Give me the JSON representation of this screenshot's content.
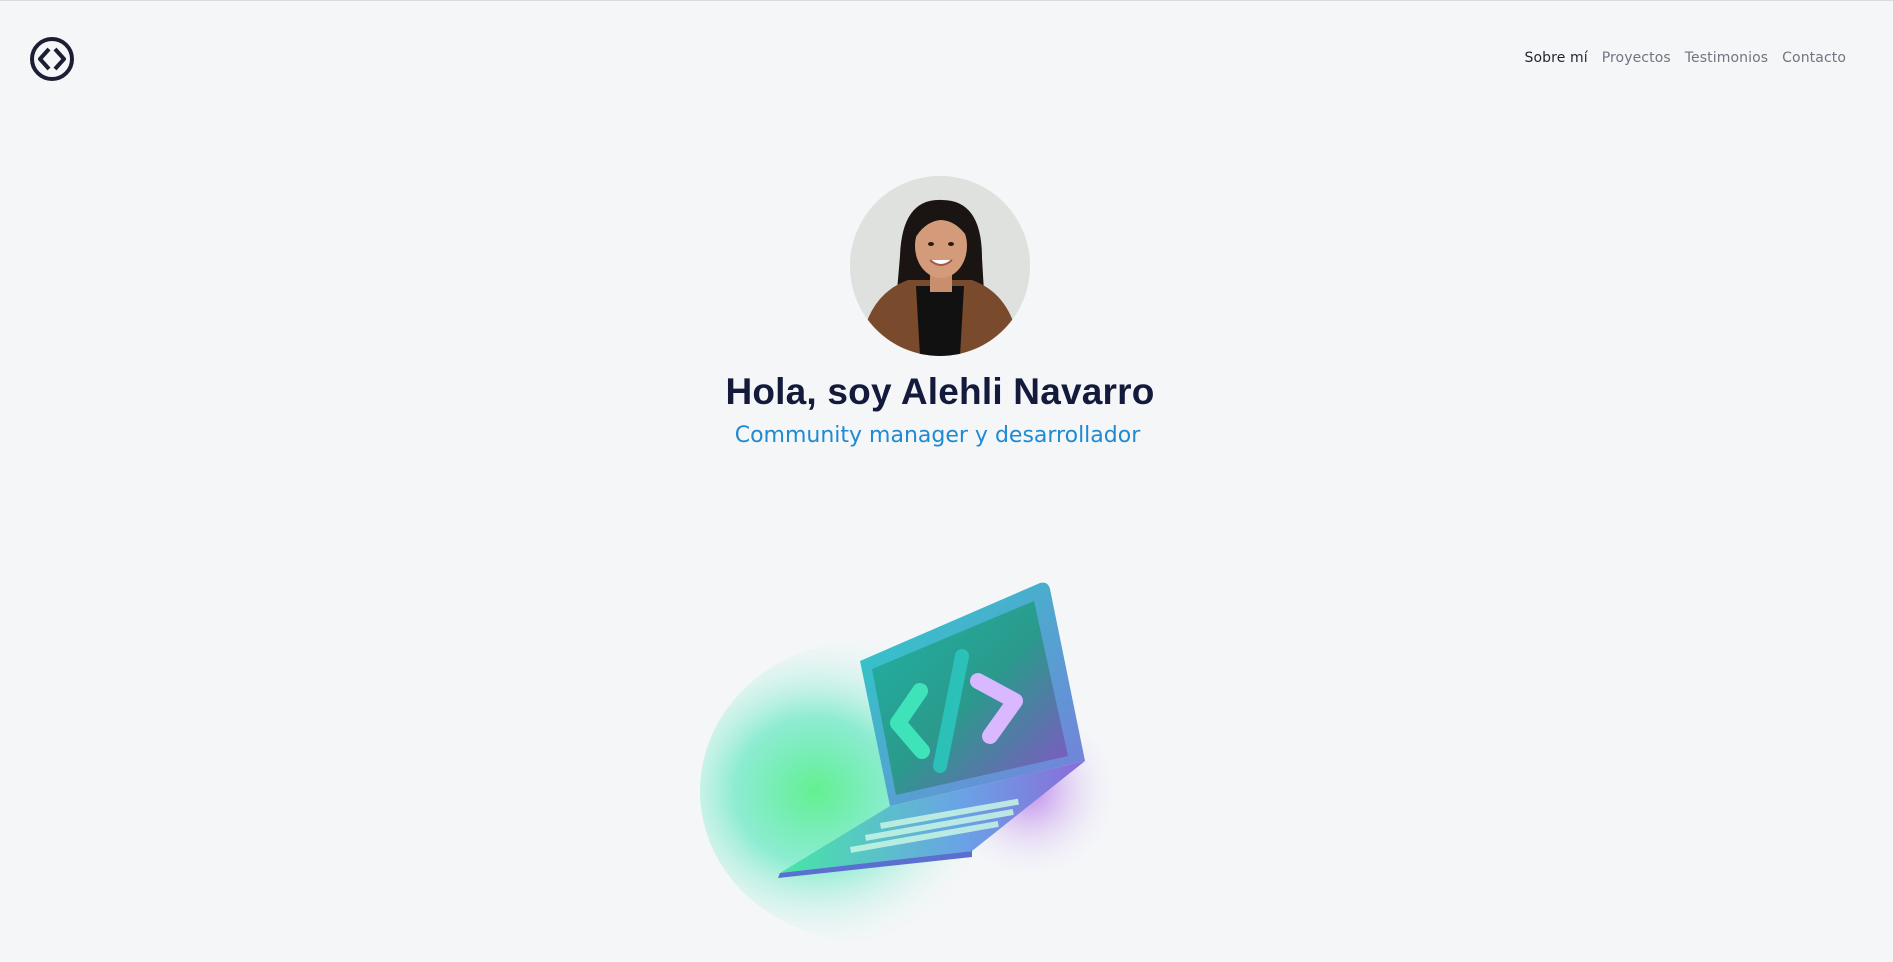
{
  "header": {
    "logo_icon": "code-brackets-circle-icon",
    "nav": [
      {
        "label": "Sobre mí",
        "active": true
      },
      {
        "label": "Proyectos",
        "active": false
      },
      {
        "label": "Testimonios",
        "active": false
      },
      {
        "label": "Contacto",
        "active": false
      }
    ]
  },
  "hero": {
    "title": "Hola, soy Alehli Navarro",
    "subtitle": "Community manager y desarrollador",
    "illustration_icon": "laptop-code-icon"
  },
  "colors": {
    "background": "#f4f6f8",
    "title": "#141a3b",
    "accent": "#1f8ad2",
    "nav_active": "#1f2530",
    "nav_inactive": "#6f7680"
  }
}
